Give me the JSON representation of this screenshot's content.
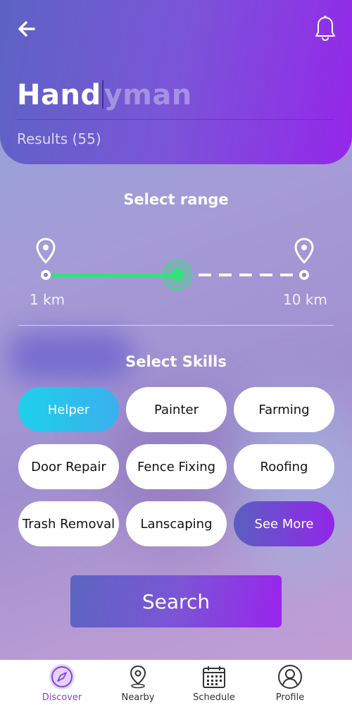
{
  "header": {
    "title_typed": "Hand",
    "title_suggest": "yman",
    "results": "Results (55)"
  },
  "range": {
    "title": "Select range",
    "min_label": "1 km",
    "max_label": "10 km",
    "selected_fraction": 0.52
  },
  "skills": {
    "title": "Select Skills",
    "chips": [
      {
        "label": "Helper",
        "active": true
      },
      {
        "label": "Painter"
      },
      {
        "label": "Farming"
      },
      {
        "label": "Door Repair"
      },
      {
        "label": "Fence Fixing"
      },
      {
        "label": "Roofing"
      },
      {
        "label": "Trash Removal"
      },
      {
        "label": "Lanscaping"
      }
    ],
    "see_more": "See More"
  },
  "search_button": "Search",
  "tabs": [
    {
      "label": "Discover",
      "icon": "compass-icon",
      "active": true
    },
    {
      "label": "Nearby",
      "icon": "map-pin-icon"
    },
    {
      "label": "Schedule",
      "icon": "calendar-icon"
    },
    {
      "label": "Profile",
      "icon": "user-icon"
    }
  ],
  "colors": {
    "accent_green": "#35e07d",
    "accent_purple": "#9526ea",
    "active_chip": "#1fd0ea",
    "active_tab": "#8a3fe0"
  }
}
